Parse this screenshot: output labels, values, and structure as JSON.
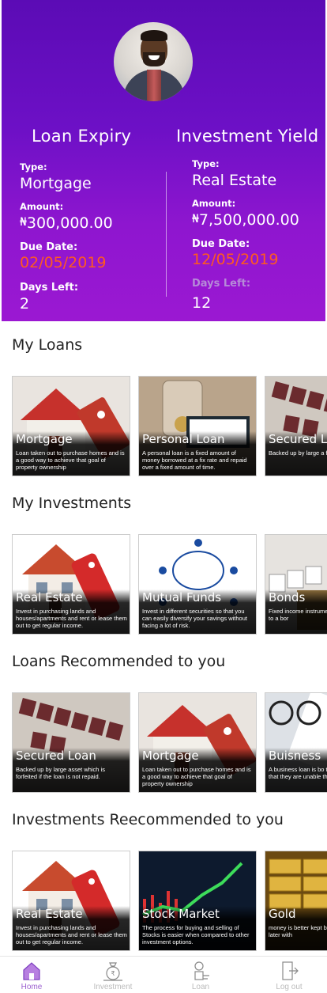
{
  "profile": {
    "avatar_alt": "profile photo"
  },
  "loan_expiry": {
    "title": "Loan Expiry",
    "type_label": "Type:",
    "type_value": "Mortgage",
    "amount_label": "Amount:",
    "amount_currency": "₦",
    "amount_value": "300,000.00",
    "due_label": "Due Date:",
    "due_value": "02/05/2019",
    "days_label": "Days Left:",
    "days_value": "2"
  },
  "investment_yield": {
    "title": "Investment Yield",
    "type_label": "Type:",
    "type_value": "Real Estate",
    "amount_label": "Amount:",
    "amount_currency": "₦",
    "amount_value": "7,500,000.00",
    "due_label": "Due Date:",
    "due_value": "12/05/2019",
    "days_label": "Days Left:",
    "days_value": "12"
  },
  "sections": [
    {
      "title": "My Loans",
      "cards": [
        {
          "title": "Mortgage",
          "desc": "Loan taken out to purchase homes and is a good way to achieve that goal of property ownership",
          "image": "house-with-loan-tag"
        },
        {
          "title": "Personal Loan",
          "desc": "A personal loan is a fixed amount of money borrowed at a fix rate and repaid over a fixed amount of time.",
          "image": "coin-jar-personal-sign"
        },
        {
          "title": "Secured L",
          "desc": "Backed up by large a forfeited if the loan is",
          "image": "secured-loan-tiles"
        }
      ]
    },
    {
      "title": "My Investments",
      "cards": [
        {
          "title": "Real Estate",
          "desc": "Invest in purchasing lands and houses/apartments and rent or lease them out to get regular income.",
          "image": "house-with-sold-tag"
        },
        {
          "title": "Mutual Funds",
          "desc": "Invest in different securities so that you can easily diversify your savings without facing a lot of risk.",
          "image": "mutual-fund-diagram"
        },
        {
          "title": "Bonds",
          "desc": "Fixed income instrumen loan made by you to a bor",
          "image": "bond-tiles"
        }
      ]
    },
    {
      "title": "Loans Recommended to you",
      "cards": [
        {
          "title": "Secured Loan",
          "desc": "Backed up by large asset which is forfeited if the loan is not repaid.",
          "image": "secured-loan-tiles"
        },
        {
          "title": "Mortgage",
          "desc": "Loan taken out to purchase homes and is a good way to achieve that goal of property ownership",
          "image": "house-with-loan-tag"
        },
        {
          "title": "Buisness",
          "desc": "A business loan is bo that companies appl that they are unable themselves.",
          "image": "glasses-on-documents"
        }
      ]
    },
    {
      "title": "Investments Reecommended to you",
      "cards": [
        {
          "title": "Real Estate",
          "desc": "Invest in purchasing lands and houses/apartments and rent or lease them out to get regular income.",
          "image": "house-with-sold-tag"
        },
        {
          "title": "Stock Market",
          "desc": "The process for buying and selling of Stocks is easier when compared to other investment options.",
          "image": "stock-ticker-board"
        },
        {
          "title": "Gold",
          "desc": "money is better kept by h invested upon later with",
          "image": "gold-bars"
        }
      ]
    }
  ],
  "nav": [
    {
      "label": "Home",
      "icon": "home-icon"
    },
    {
      "label": "Investment",
      "icon": "money-bag-icon"
    },
    {
      "label": "Loan",
      "icon": "loan-hand-icon"
    },
    {
      "label": "Log out",
      "icon": "logout-icon"
    }
  ]
}
